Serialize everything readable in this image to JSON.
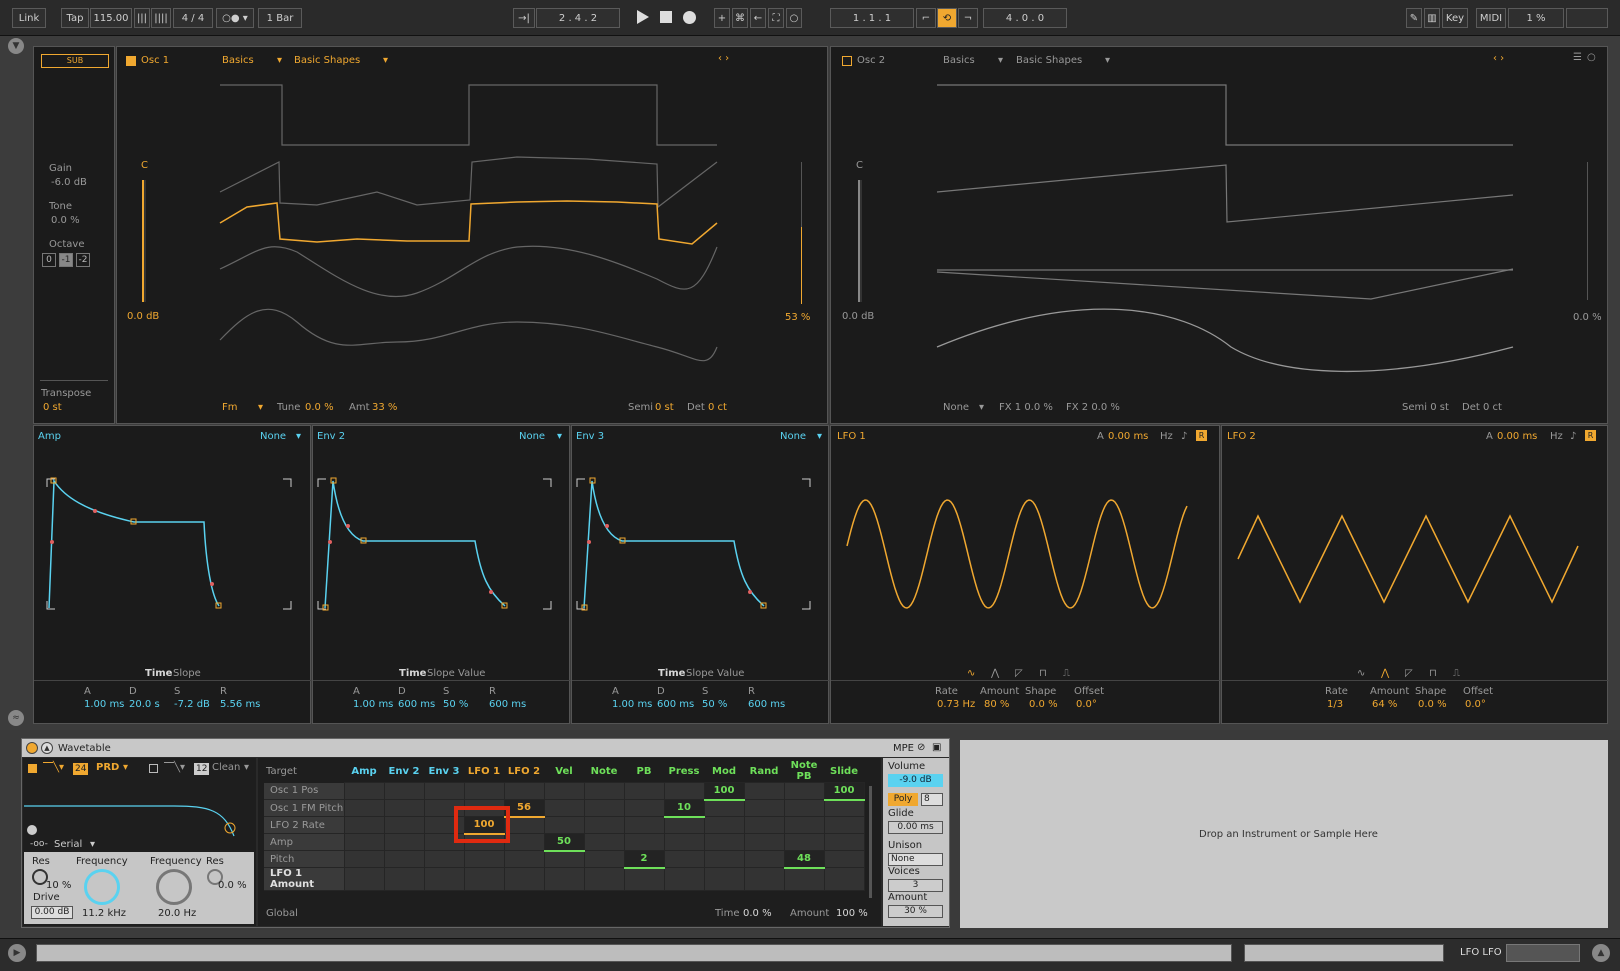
{
  "transport": {
    "link": "Link",
    "tap": "Tap",
    "bpm": "115.00",
    "meter": "4 / 4",
    "quant": "1 Bar",
    "pos": "2 .  4 .  2",
    "loop_start": "1 .  1 .  1",
    "loop_len": "4 .  0 .  0",
    "key": "Key",
    "midi": "MIDI",
    "cpu": "1 %"
  },
  "sub": {
    "badge": "SUB",
    "gain_label": "Gain",
    "gain": "-6.0 dB",
    "tone_label": "Tone",
    "tone": "0.0 %",
    "octave_label": "Octave",
    "octaves": [
      "0",
      "-1",
      "-2"
    ],
    "transpose_label": "Transpose",
    "transpose": "0 st"
  },
  "osc1": {
    "title": "Osc 1",
    "category": "Basics",
    "wavetable": "Basic Shapes",
    "note": "C",
    "gain": "0.0 dB",
    "pos": "53 %",
    "fx": "Fm",
    "tune_label": "Tune",
    "tune": "0.0 %",
    "amt_label": "Amt",
    "amt": "33 %",
    "semi_label": "Semi",
    "semi": "0 st",
    "det_label": "Det",
    "det": "0 ct"
  },
  "osc2": {
    "title": "Osc 2",
    "category": "Basics",
    "wavetable": "Basic Shapes",
    "note": "C",
    "gain": "0.0 dB",
    "pos": "0.0 %",
    "fx": "None",
    "fx1": "FX 1 0.0 %",
    "fx2": "FX 2 0.0 %",
    "semi": "Semi 0 st",
    "det": "Det 0 ct"
  },
  "env_amp": {
    "title": "Amp",
    "mod": "None",
    "tabs": [
      "Time",
      "Slope"
    ],
    "labels": [
      "A",
      "D",
      "S",
      "R"
    ],
    "values": [
      "1.00 ms",
      "20.0 s",
      "-7.2 dB",
      "5.56 ms"
    ]
  },
  "env2": {
    "title": "Env 2",
    "mod": "None",
    "tabs": [
      "Time",
      "Slope",
      "Value"
    ],
    "labels": [
      "A",
      "D",
      "S",
      "R"
    ],
    "values": [
      "1.00 ms",
      "600 ms",
      "50 %",
      "600 ms"
    ]
  },
  "env3": {
    "title": "Env 3",
    "mod": "None",
    "tabs": [
      "Time",
      "Slope",
      "Value"
    ],
    "labels": [
      "A",
      "D",
      "S",
      "R"
    ],
    "values": [
      "1.00 ms",
      "600 ms",
      "50 %",
      "600 ms"
    ]
  },
  "lfo1": {
    "title": "LFO 1",
    "a_label": "A",
    "a": "0.00 ms",
    "unit": "Hz",
    "labels": [
      "Rate",
      "Amount",
      "Shape",
      "Offset"
    ],
    "values": [
      "0.73 Hz",
      "80 %",
      "0.0 %",
      "0.0°"
    ]
  },
  "lfo2": {
    "title": "LFO 2",
    "a_label": "A",
    "a": "0.00 ms",
    "unit": "Hz",
    "labels": [
      "Rate",
      "Amount",
      "Shape",
      "Offset"
    ],
    "values": [
      "1/3",
      "64 %",
      "0.0 %",
      "0.0°"
    ]
  },
  "device": {
    "name": "Wavetable",
    "mpe": "MPE",
    "filter_freq_val": "24",
    "filter_type": "PRD",
    "filter2_val": "12",
    "filter2_type": "Clean",
    "routing": "Serial",
    "res_label": "Res",
    "res": "10 %",
    "drive_label": "Drive",
    "drive": "0.00 dB",
    "freq_label": "Frequency",
    "freq": "11.2 kHz",
    "freq2_label": "Frequency",
    "freq2": "20.0 Hz",
    "res2_label": "Res",
    "res2": "0.0 %"
  },
  "matrix": {
    "target": "Target",
    "sources": [
      "Amp",
      "Env 2",
      "Env 3",
      "LFO 1",
      "LFO 2",
      "Vel",
      "Note",
      "PB",
      "Press",
      "Mod",
      "Rand",
      "Note PB",
      "Slide"
    ],
    "rows": [
      {
        "name": "Osc 1 Pos",
        "cells": [
          "",
          "",
          "",
          "",
          "",
          "",
          "",
          "",
          "",
          "100",
          "",
          "",
          "100"
        ]
      },
      {
        "name": "Osc 1 FM Pitch",
        "cells": [
          "",
          "",
          "",
          "",
          "56",
          "",
          "",
          "",
          "10",
          "",
          "",
          "",
          ""
        ]
      },
      {
        "name": "LFO 2 Rate",
        "cells": [
          "",
          "",
          "",
          "100",
          "",
          "",
          "",
          "",
          "",
          "",
          "",
          "",
          ""
        ]
      },
      {
        "name": "Amp",
        "cells": [
          "",
          "",
          "",
          "",
          "",
          "50",
          "",
          "",
          "",
          "",
          "",
          "",
          ""
        ]
      },
      {
        "name": "Pitch",
        "cells": [
          "",
          "",
          "",
          "",
          "",
          "",
          "",
          "2",
          "",
          "",
          "",
          "48",
          ""
        ]
      },
      {
        "name": "LFO 1 Amount",
        "cells": [
          "",
          "",
          "",
          "",
          "",
          "",
          "",
          "",
          "",
          "",
          "",
          "",
          ""
        ]
      }
    ],
    "global": "Global",
    "time_label": "Time",
    "time": "0.0 %",
    "amount_label": "Amount",
    "amount": "100 %"
  },
  "voice": {
    "volume_label": "Volume",
    "volume": "-9.0 dB",
    "poly": "Poly",
    "voices_n": "8",
    "glide_label": "Glide",
    "glide": "0.00 ms",
    "unison_label": "Unison",
    "unison": "None",
    "voices_label": "Voices",
    "voices": "3",
    "amount_label": "Amount",
    "amount": "30 %"
  },
  "drop": "Drop an Instrument or Sample Here",
  "status": {
    "track": "LFO LFO"
  },
  "colors": {
    "orange": "#f0a830",
    "blue": "#5ad2f0",
    "green": "#6ee05a"
  }
}
